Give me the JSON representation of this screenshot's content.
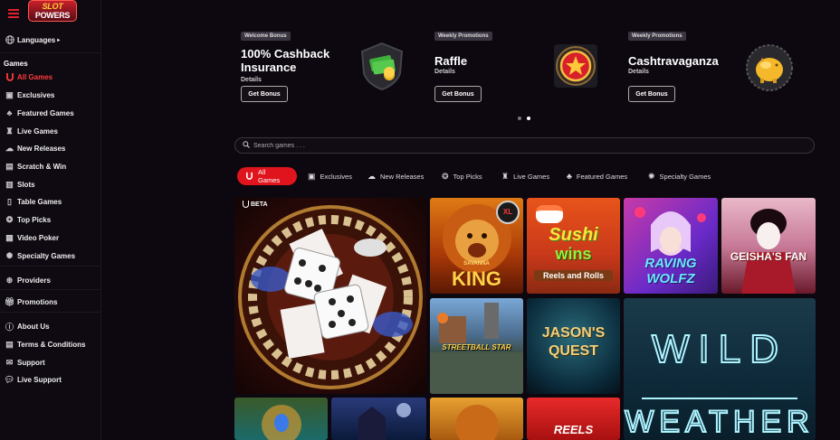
{
  "brand": {
    "logo_line1": "SLOT",
    "logo_line2": "POWERS"
  },
  "sidebar": {
    "languages": "Languages",
    "games_heading": "Games",
    "games": [
      {
        "label": "All Games",
        "icon": "horseshoe-icon",
        "active": true
      },
      {
        "label": "Exclusives",
        "icon": "exclusive-icon"
      },
      {
        "label": "Featured Games",
        "icon": "featured-icon"
      },
      {
        "label": "Live Games",
        "icon": "live-icon"
      },
      {
        "label": "New Releases",
        "icon": "new-releases-icon"
      },
      {
        "label": "Scratch & Win",
        "icon": "scratch-icon"
      },
      {
        "label": "Slots",
        "icon": "slots-icon"
      },
      {
        "label": "Table Games",
        "icon": "table-icon"
      },
      {
        "label": "Top Picks",
        "icon": "top-picks-icon"
      },
      {
        "label": "Video Poker",
        "icon": "video-poker-icon"
      },
      {
        "label": "Specialty Games",
        "icon": "specialty-icon"
      }
    ],
    "providers": "Providers",
    "promotions": "Promotions",
    "footer_links": [
      "About Us",
      "Terms & Conditions",
      "Support",
      "Live Support"
    ]
  },
  "promos": [
    {
      "tag": "Welcome Bonus",
      "title": "100% Cashback Insurance",
      "details": "Details",
      "button": "Get Bonus",
      "art": "cash-shield-icon"
    },
    {
      "tag": "Weekly Promotions",
      "title": "Raffle",
      "details": "Details",
      "button": "Get Bonus",
      "art": "star-badge-icon"
    },
    {
      "tag": "Weekly Promotions",
      "title": "Cashtravaganza",
      "details": "Details",
      "button": "Get Bonus",
      "art": "piggy-bank-icon"
    }
  ],
  "carousel": {
    "total": 2,
    "active": 2
  },
  "search": {
    "placeholder": "Search games . . ."
  },
  "filters": [
    {
      "label": "All Games",
      "icon": "horseshoe-icon",
      "active": true
    },
    {
      "label": "Exclusives",
      "icon": "exclusive-icon"
    },
    {
      "label": "New Releases",
      "icon": "new-releases-icon"
    },
    {
      "label": "Top Picks",
      "icon": "top-picks-icon"
    },
    {
      "label": "Live Games",
      "icon": "live-icon"
    },
    {
      "label": "Featured Games",
      "icon": "featured-icon"
    },
    {
      "label": "Specialty Games",
      "icon": "specialty-icon"
    }
  ],
  "games": {
    "beta_badge": "BETA",
    "savanna_king": {
      "line1": "SAVANNA",
      "line2": "KING",
      "badge": "XL"
    },
    "sushi_wins": {
      "line1": "Sushi",
      "line2": "wins",
      "sub": "Reels and Rolls"
    },
    "raving_wolfz": {
      "title": "RAVING WOLFZ"
    },
    "geishas_fan": {
      "title": "GEISHA'S FAN"
    },
    "streetball_star": {
      "title": "STREETBALL STAR"
    },
    "jasons_quest": {
      "line1": "JASON'S",
      "line2": "QUEST"
    },
    "wild_weather": {
      "line1": "WILD",
      "line2": "WEATHER"
    },
    "reels_tile": {
      "title": "REELS"
    }
  },
  "colors": {
    "accent": "#e0141c",
    "background": "#0d0810",
    "sidebar": "#0f0a12"
  }
}
